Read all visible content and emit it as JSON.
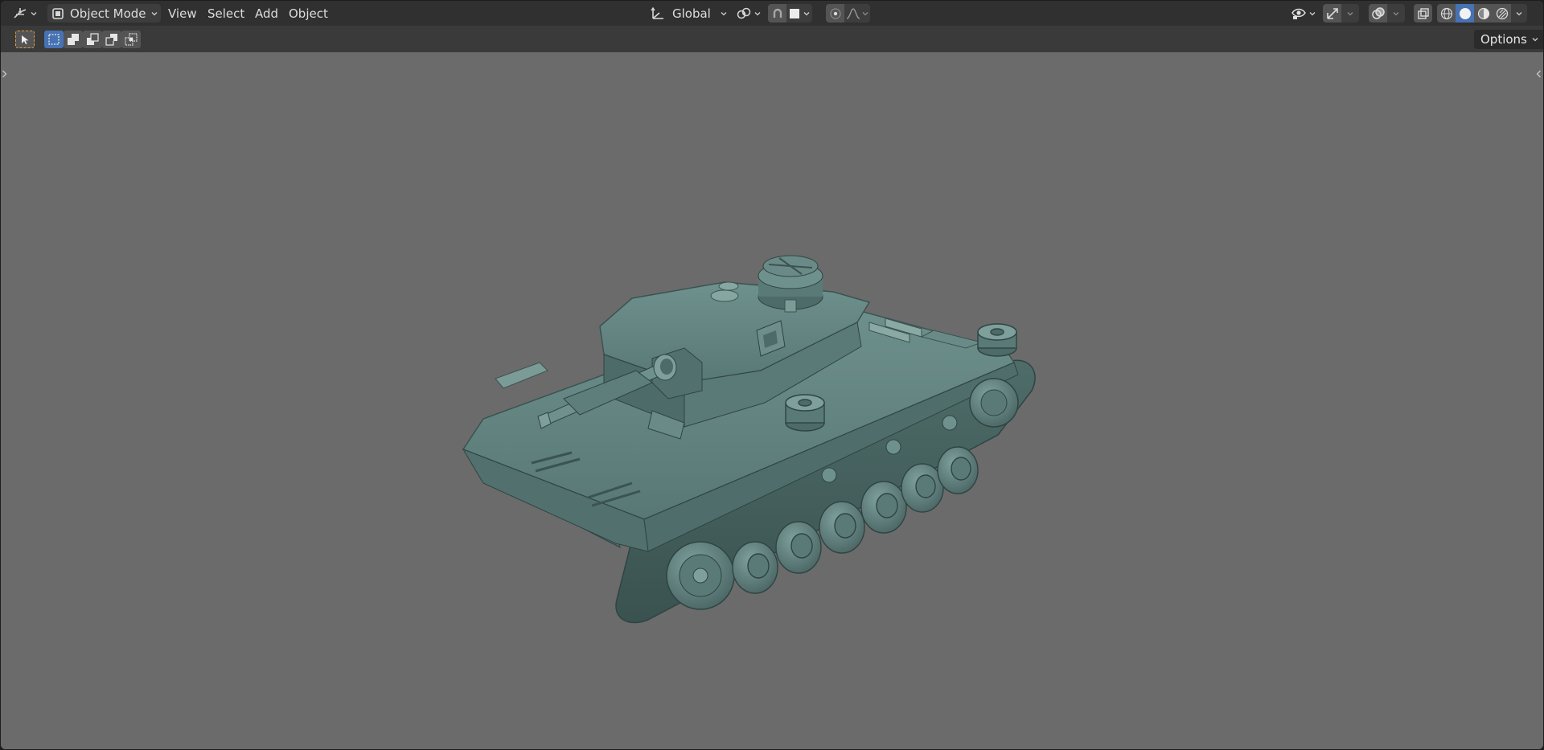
{
  "header": {
    "mode": {
      "label": "Object Mode"
    },
    "menus": [
      {
        "label": "View"
      },
      {
        "label": "Select"
      },
      {
        "label": "Add"
      },
      {
        "label": "Object"
      }
    ],
    "orientation": {
      "label": "Global"
    }
  },
  "tool_header": {
    "options": {
      "label": "Options"
    }
  },
  "icons": {
    "editor_type": "viewport-editor-icon",
    "mode": "object-mode-icon",
    "transform_orientation": "transform-orientation-icon",
    "pivot": "pivot-point-icon",
    "snap": "snap-magnet-icon",
    "proportional": "proportional-editing-icon",
    "falloff": "falloff-curve-icon",
    "visibility": "object-visibility-icon",
    "gizmo": "gizmo-icon",
    "overlay": "overlay-icon",
    "xray": "xray-icon",
    "shading_wire": "wireframe-shading-icon",
    "shading_solid": "solid-shading-icon",
    "shading_material": "material-preview-icon",
    "shading_rendered": "rendered-shading-icon",
    "select_tool": "select-box-tool-icon",
    "select_new": "select-new-icon",
    "select_extend": "select-extend-icon",
    "select_subtract": "select-subtract-icon",
    "select_invert": "select-invert-icon",
    "select_intersect": "select-intersect-icon"
  },
  "colors": {
    "header_bg": "#303030",
    "tool_header_bg": "#3a3a3a",
    "viewport_bg": "#6b6b6b",
    "accent_active": "#4772b3",
    "tank_body": "#5c7c79",
    "tank_shadow": "#3b5351",
    "tank_highlight": "#8fb0ac"
  }
}
